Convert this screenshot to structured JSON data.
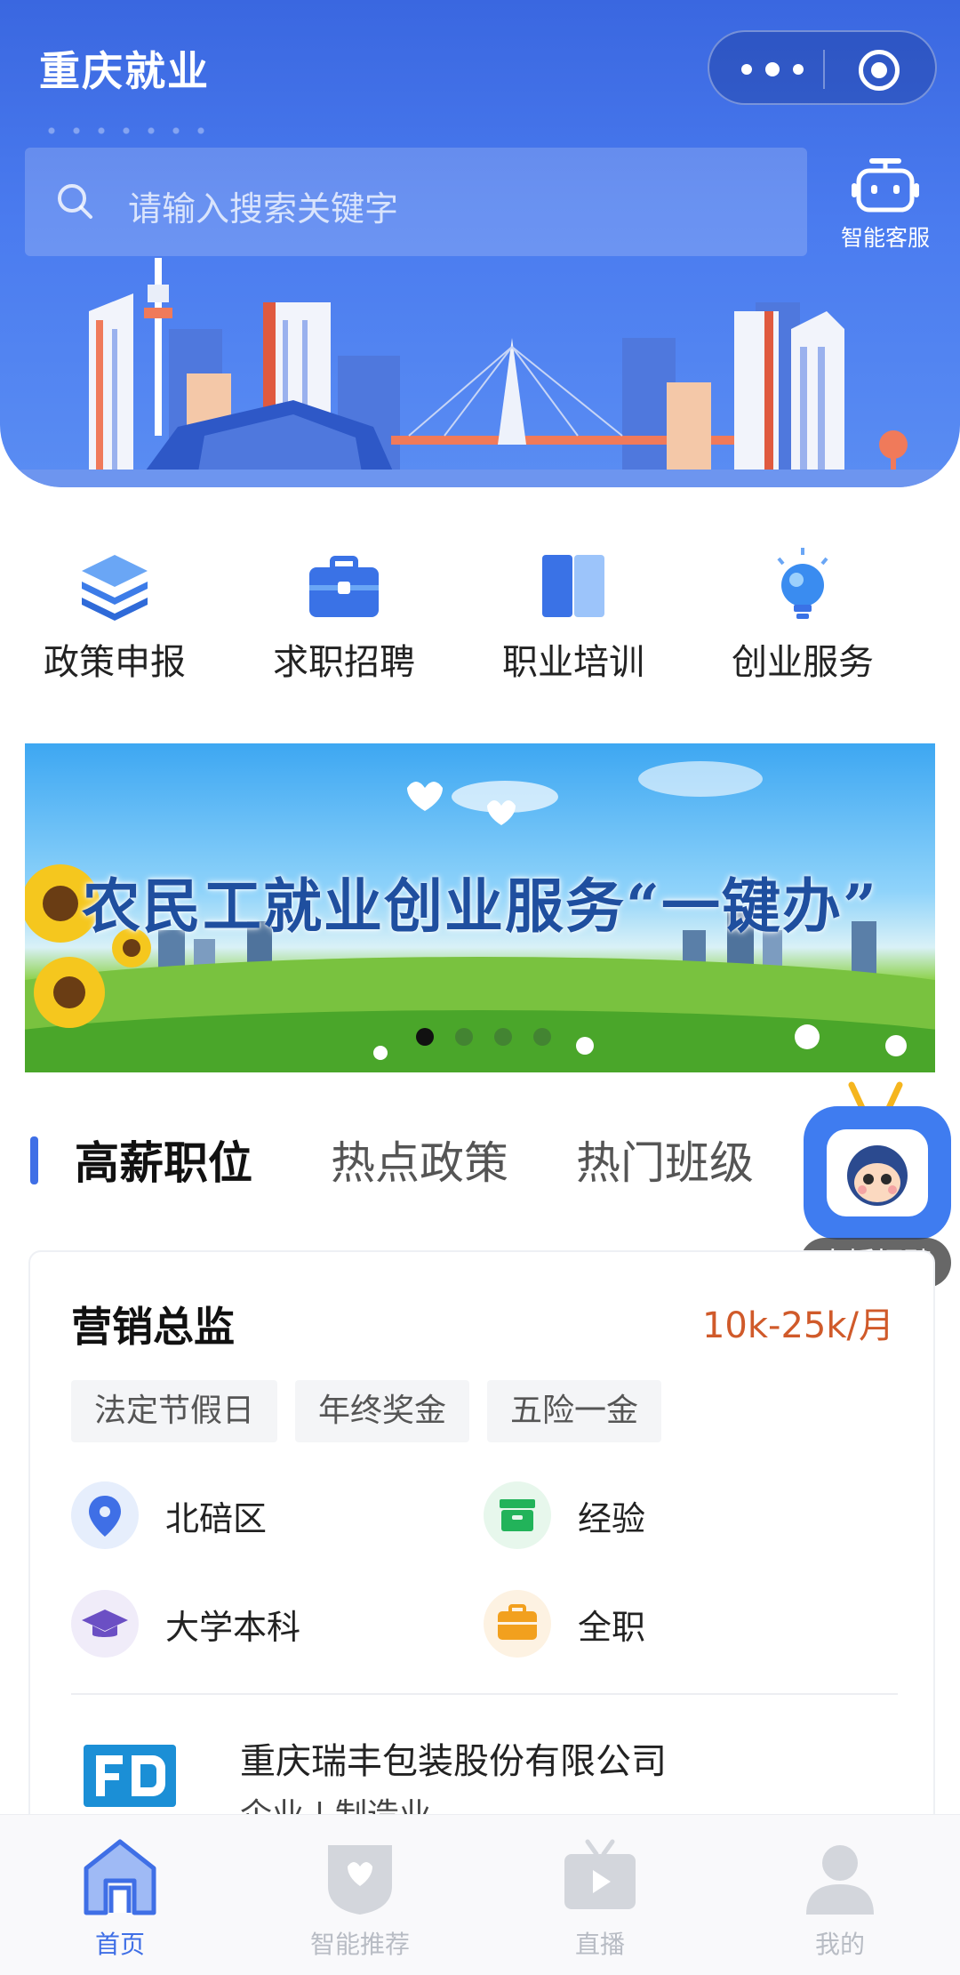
{
  "header": {
    "app_title": "重庆就业",
    "search_placeholder": "请输入搜索关键字",
    "assistant_label": "智能客服"
  },
  "quick_menu": [
    {
      "label": "政策申报",
      "icon": "layers-icon"
    },
    {
      "label": "求职招聘",
      "icon": "briefcase-icon"
    },
    {
      "label": "职业培训",
      "icon": "book-icon"
    },
    {
      "label": "创业服务",
      "icon": "lightbulb-icon"
    }
  ],
  "banner": {
    "title": "农民工就业创业服务“一键办”",
    "slide_count": 4,
    "active_slide": 1
  },
  "section_tabs": {
    "items": [
      "高薪职位",
      "热点政策",
      "热门班级"
    ],
    "active": "高薪职位"
  },
  "live_button": {
    "label": "直播招聘"
  },
  "job": {
    "title": "营销总监",
    "salary": "10k-25k/月",
    "tags": [
      "法定节假日",
      "年终奖金",
      "五险一金"
    ],
    "location": "北碚区",
    "experience": "经验",
    "education": "大学本科",
    "type": "全职",
    "company": "重庆瑞丰包装股份有限公司",
    "company_meta": "企业 | 制造业"
  },
  "tabbar": {
    "items": [
      {
        "label": "首页",
        "icon": "home-icon",
        "active": true
      },
      {
        "label": "智能推荐",
        "icon": "heart-shield-icon",
        "active": false
      },
      {
        "label": "直播",
        "icon": "tv-play-icon",
        "active": false
      },
      {
        "label": "我的",
        "icon": "user-icon",
        "active": false
      }
    ]
  },
  "colors": {
    "primary": "#3f6fe6",
    "salary": "#d05a2a",
    "header_bg": "#4a7bef"
  }
}
